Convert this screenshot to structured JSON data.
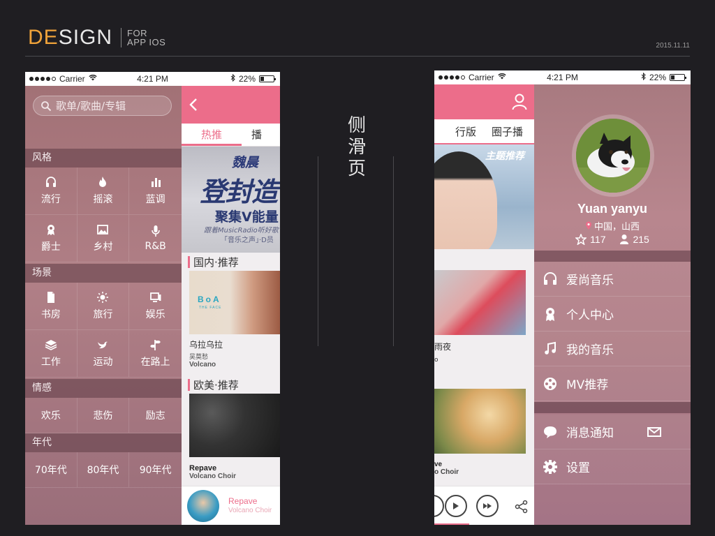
{
  "header": {
    "brand_de": "DE",
    "brand_sign": "SIGN",
    "brand_sub_1": "FOR",
    "brand_sub_2": "APP IOS",
    "date": "2015.11.11"
  },
  "center_title": [
    "侧",
    "滑",
    "页"
  ],
  "statusbar": {
    "carrier": "Carrier",
    "time": "4:21 PM",
    "battery": "22%"
  },
  "left_phone": {
    "search": {
      "placeholder": "歌单/歌曲/专辑"
    },
    "sections": [
      {
        "title": "风格",
        "items": [
          {
            "label": "流行",
            "icon": "headphones-icon"
          },
          {
            "label": "摇滚",
            "icon": "flame-icon"
          },
          {
            "label": "蓝调",
            "icon": "bars-icon"
          },
          {
            "label": "爵士",
            "icon": "badge-icon"
          },
          {
            "label": "乡村",
            "icon": "picture-icon"
          },
          {
            "label": "R&B",
            "icon": "microphone-icon"
          }
        ]
      },
      {
        "title": "场景",
        "items": [
          {
            "label": "书房",
            "icon": "document-icon"
          },
          {
            "label": "旅行",
            "icon": "sun-icon"
          },
          {
            "label": "娱乐",
            "icon": "screen-icon"
          },
          {
            "label": "工作",
            "icon": "layers-icon"
          },
          {
            "label": "运动",
            "icon": "bird-icon"
          },
          {
            "label": "在路上",
            "icon": "signpost-icon"
          }
        ]
      },
      {
        "title": "情感",
        "items": [
          {
            "label": "欢乐"
          },
          {
            "label": "悲伤"
          },
          {
            "label": "励志"
          }
        ]
      },
      {
        "title": "年代",
        "items": [
          {
            "label": "70年代"
          },
          {
            "label": "80年代"
          },
          {
            "label": "90年代"
          }
        ]
      }
    ],
    "content": {
      "tabs": [
        "热推",
        "播"
      ],
      "banner": {
        "line1": "魏晨",
        "line2": "登封造",
        "line3": "聚集V能量",
        "line4": "跟着MusicRadio听好歌",
        "line5": "「音乐之声」·D员"
      },
      "section1": "国内·推荐",
      "album1": {
        "logo": "BoA",
        "logo_sub": "THE FACE",
        "title": "乌拉乌拉",
        "sub": "吴莫愁",
        "artist": "Volcano"
      },
      "section2": "欧美·推荐",
      "album2": {
        "title": "Repave",
        "artist": "Volcano Choir"
      },
      "mini_player": {
        "title": "Repave",
        "artist": "Volcano Choir"
      }
    }
  },
  "right_phone": {
    "content": {
      "tabs": [
        "行版",
        "圈子播"
      ],
      "banner_text": "主题推荐",
      "song1_title": "雨夜",
      "song1_sub": "o",
      "song2_title": "ve",
      "song2_artist": "o Choir",
      "player_progress": 0.35
    },
    "profile": {
      "name": "Yuan yanyu",
      "location": "中国，山西",
      "stars": "117",
      "followers": "215"
    },
    "menu": [
      {
        "label": "爱尚音乐",
        "icon": "headphones-icon"
      },
      {
        "label": "个人中心",
        "icon": "badge-icon"
      },
      {
        "label": "我的音乐",
        "icon": "music-note-icon"
      },
      {
        "label": "MV推荐",
        "icon": "film-reel-icon"
      }
    ],
    "menu2": [
      {
        "label": "消息通知",
        "icon": "chat-bubble-icon"
      },
      {
        "label": "设置",
        "icon": "gear-icon"
      }
    ]
  },
  "colors": {
    "accent": "#ec6d8a",
    "brand_orange": "#f0a33a",
    "background": "#1f1e22"
  }
}
